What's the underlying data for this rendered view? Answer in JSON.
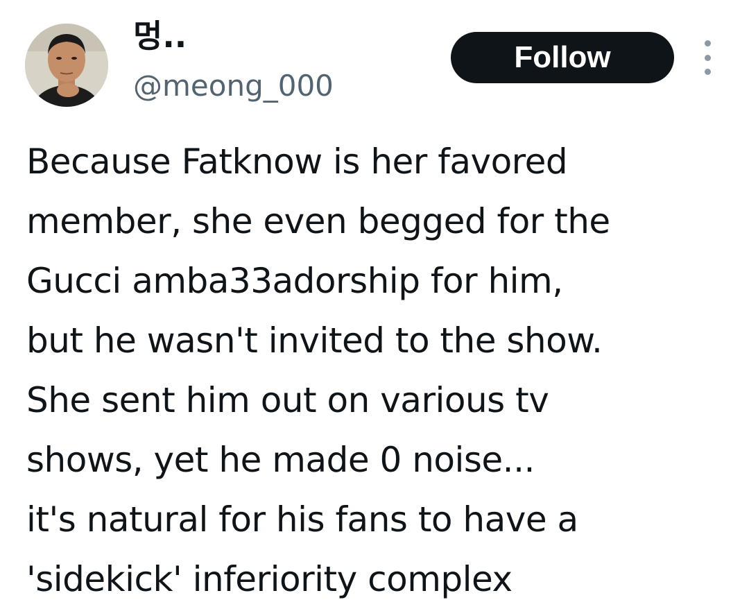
{
  "author": {
    "display_name": "멍..",
    "handle": "@meong_000"
  },
  "actions": {
    "follow_label": "Follow",
    "more_icon": "more-horizontal-icon"
  },
  "tweet": {
    "lines": [
      "Because Fatknow is her favored",
      "member, she even begged for the",
      "Gucci amba33adorship for him,",
      "but he wasn't invited to the show.",
      "She sent him out on various tv",
      "shows, yet he made 0 noise...",
      "it's natural for his fans to have a",
      "'sidekick' inferiority complex"
    ]
  },
  "colors": {
    "text_primary": "#0f1419",
    "text_secondary": "#536471",
    "button_bg": "#0f1419",
    "button_text": "#ffffff"
  }
}
